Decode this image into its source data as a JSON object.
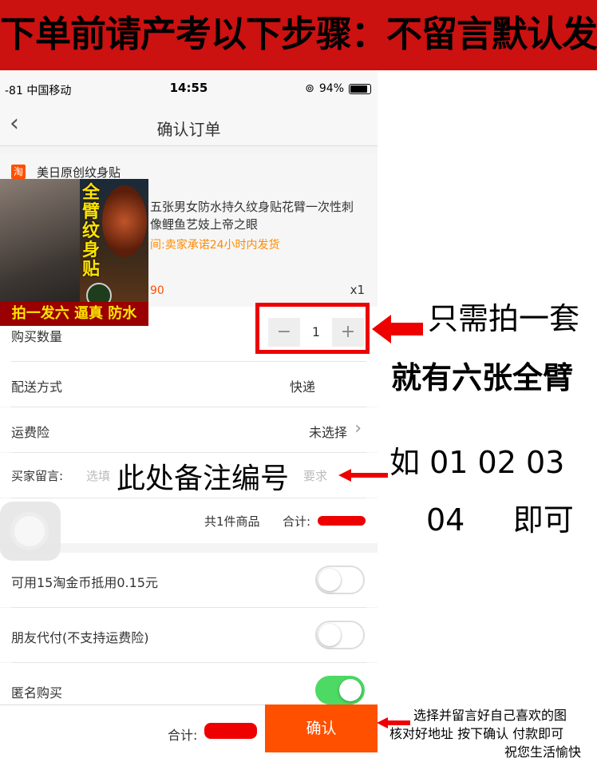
{
  "banner": {
    "text": "下单前请产考以下步骤：不留言默认发"
  },
  "status_bar": {
    "carrier": "-81 中国移动",
    "time": "14:55",
    "battery": "94%"
  },
  "nav": {
    "back_icon": "chevron-left-icon",
    "title": "确认订单"
  },
  "shop": {
    "icon_text": "淘",
    "name": "美日原创纹身贴"
  },
  "product": {
    "image_vertical_text": "全臂纹身贴",
    "image_bottom_text": "拍一发六 逼真 防水",
    "title": "五张男女防水持久纹身贴花臂一次性刺青像鲤鱼艺妓上帝之眼",
    "title_display": "五张男女防水持久纹身贴花臂一次性刺\n像鲤鱼艺妓上帝之眼",
    "shipping_note": "间:卖家承诺24小时内发货",
    "price_fragment": "90",
    "quantity": "x1"
  },
  "order": {
    "qty_label": "购买数量",
    "qty_value": "1",
    "delivery_label": "配送方式",
    "delivery_value": "快递",
    "insurance_label": "运费险",
    "insurance_value": "未选择",
    "message_label": "买家留言:",
    "message_placeholder_left": "选填",
    "message_placeholder_right": "要求",
    "summary_count": "共1件商品",
    "summary_total_label": "合计:"
  },
  "options": [
    {
      "label": "可用15淘金币抵用0.15元",
      "on": false
    },
    {
      "label": "朋友代付(不支持运费险)",
      "on": false
    },
    {
      "label": "匿名购买",
      "on": true
    }
  ],
  "footer": {
    "total_label": "合计:",
    "confirm_label": "确认"
  },
  "annotations": {
    "only_one_set": "只需拍一套",
    "six_full_arms": "就有六张全臂",
    "note_number": "此处备注编号",
    "example_line1": "如  01 02 03",
    "example_line2": "04     即可",
    "instructions_line1": "选择并留言好自己喜欢的图",
    "instructions_line2": "核对好地址 按下确认 付款即可",
    "instructions_line3": "祝您生活愉快"
  },
  "colors": {
    "banner": "#cc1111",
    "accent": "#ff5000",
    "annotation_red": "#e00000",
    "toggle_on": "#4cd964"
  }
}
